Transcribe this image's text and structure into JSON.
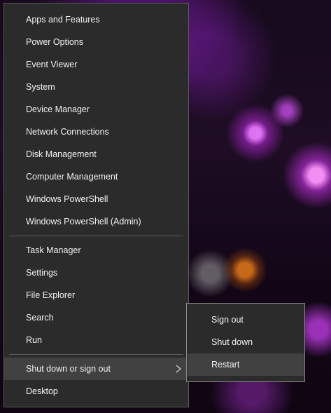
{
  "winx_menu": {
    "group1": [
      {
        "label": "Apps and Features"
      },
      {
        "label": "Power Options"
      },
      {
        "label": "Event Viewer"
      },
      {
        "label": "System"
      },
      {
        "label": "Device Manager"
      },
      {
        "label": "Network Connections"
      },
      {
        "label": "Disk Management"
      },
      {
        "label": "Computer Management"
      },
      {
        "label": "Windows PowerShell"
      },
      {
        "label": "Windows PowerShell (Admin)"
      }
    ],
    "group2": [
      {
        "label": "Task Manager"
      },
      {
        "label": "Settings"
      },
      {
        "label": "File Explorer"
      },
      {
        "label": "Search"
      },
      {
        "label": "Run"
      }
    ],
    "shutdown_item": {
      "label": "Shut down or sign out",
      "icon": "chevron-right-icon"
    },
    "desktop_item": {
      "label": "Desktop"
    }
  },
  "submenu": {
    "items": [
      {
        "label": "Sign out"
      },
      {
        "label": "Shut down"
      },
      {
        "label": "Restart"
      }
    ],
    "highlighted": "Restart"
  },
  "colors": {
    "menu_bg": "#2b2b2b",
    "hover_bg": "#414141",
    "text": "#f2f2f2",
    "separator": "#5d5d5d"
  }
}
